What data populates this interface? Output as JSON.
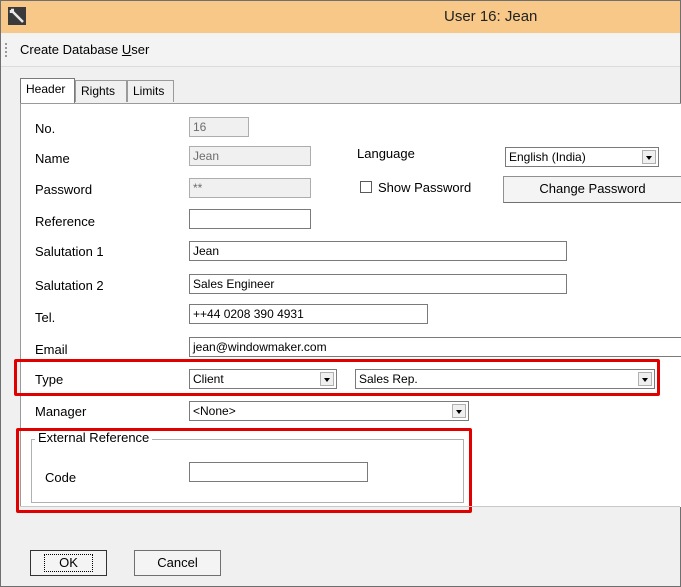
{
  "window": {
    "title": "User 16: Jean"
  },
  "toolbar": {
    "label_pre": "Create Database ",
    "label_key": "U",
    "label_post": "ser"
  },
  "tabs": [
    {
      "label": "Header",
      "active": true
    },
    {
      "label": "Rights",
      "active": false
    },
    {
      "label": "Limits",
      "active": false
    }
  ],
  "form": {
    "no": {
      "label": "No.",
      "value": "16"
    },
    "name": {
      "label": "Name",
      "value": "Jean"
    },
    "password": {
      "label": "Password",
      "value": "**"
    },
    "language": {
      "label": "Language",
      "value": "English (India)"
    },
    "show_password": {
      "label": "Show Password",
      "checked": false
    },
    "change_password": {
      "label": "Change Password"
    },
    "reference": {
      "label": "Reference",
      "value": ""
    },
    "salutation1": {
      "label": "Salutation 1",
      "value": "Jean"
    },
    "salutation2": {
      "label": "Salutation 2",
      "value": "Sales Engineer"
    },
    "tel": {
      "label": "Tel.",
      "value": "++44 0208 390 4931"
    },
    "email": {
      "label": "Email",
      "value": "jean@windowmaker.com"
    },
    "type": {
      "label": "Type",
      "value": "Client",
      "value2": "Sales Rep."
    },
    "manager": {
      "label": "Manager",
      "value": "<None>"
    },
    "external_reference": {
      "legend": "External Reference",
      "code_label": "Code",
      "code_value": ""
    }
  },
  "buttons": {
    "ok": "OK",
    "cancel": "Cancel"
  },
  "colors": {
    "titlebar": "#f7c888",
    "highlight": "#e00000"
  }
}
